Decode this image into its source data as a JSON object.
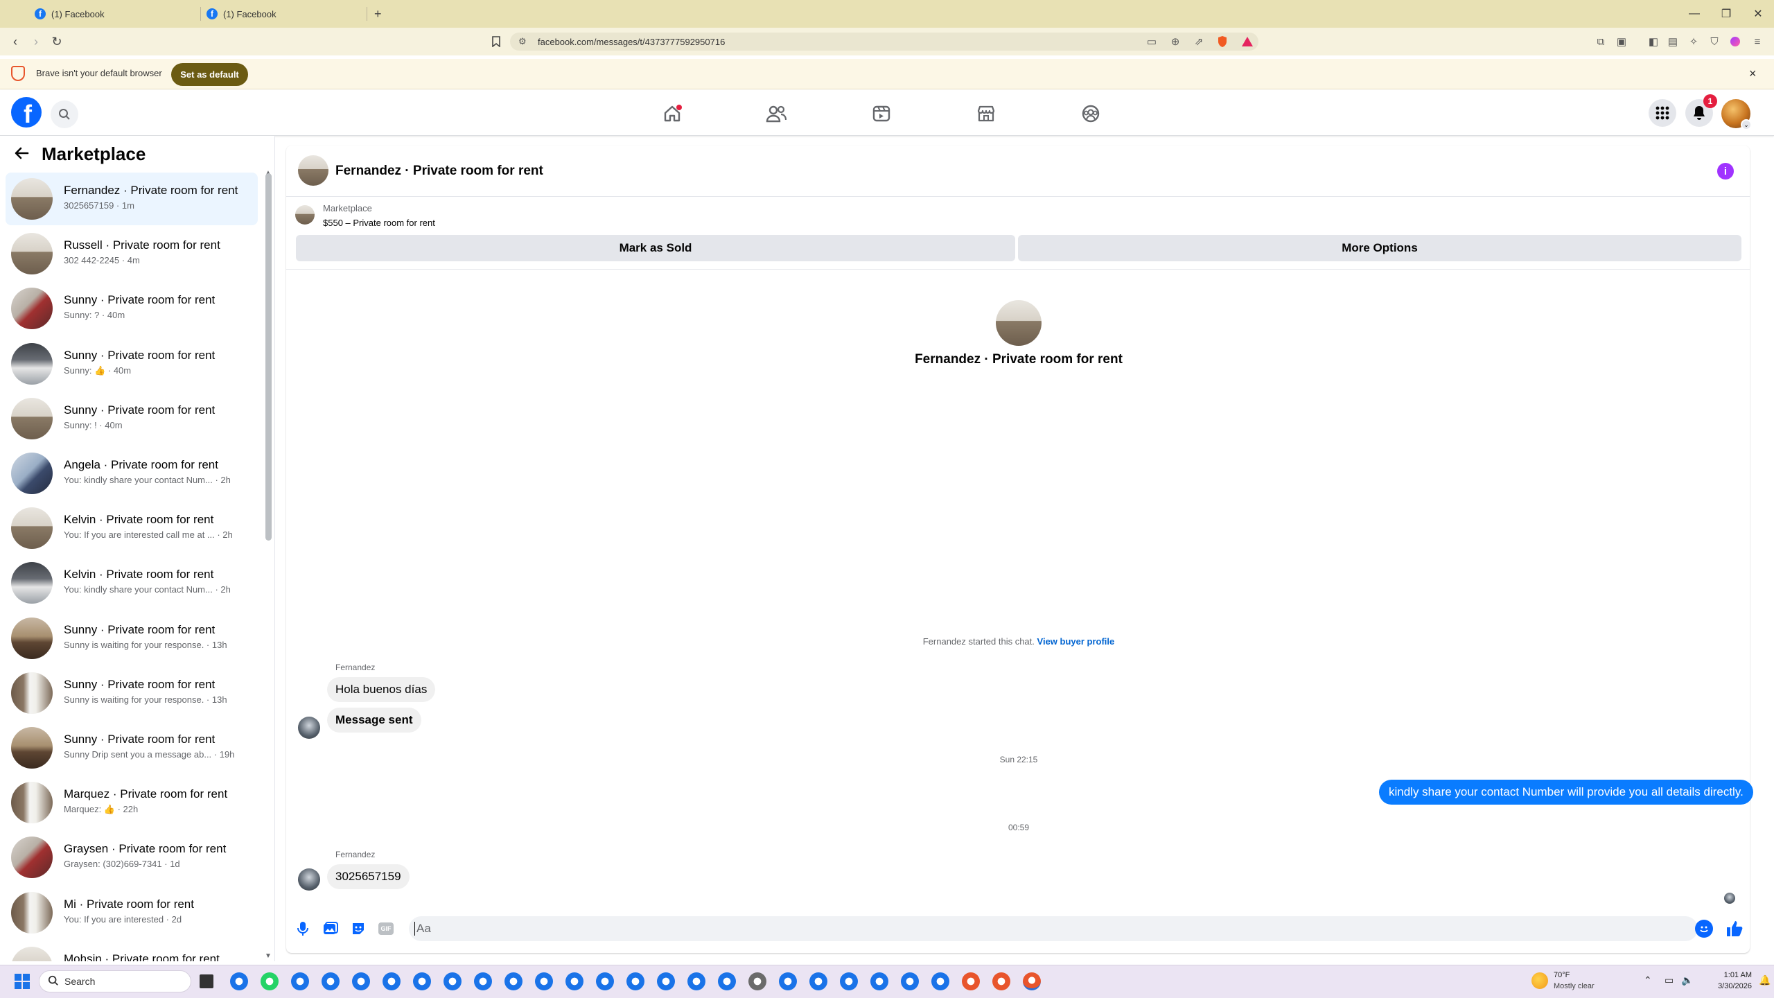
{
  "browser": {
    "tabs": [
      {
        "title": "(1) Facebook",
        "active": true
      },
      {
        "title": "(1) Facebook",
        "active": false
      }
    ],
    "new_tab": "+",
    "url": "facebook.com/messages/t/4373777592950716",
    "infobar": {
      "message": "Brave isn't your default browser",
      "button": "Set as default",
      "close": "×"
    }
  },
  "facebook": {
    "logo": "f",
    "notifications_count": "1",
    "accent": "#0866ff"
  },
  "sidebar": {
    "title": "Marketplace",
    "conversations": [
      {
        "name": "Fernandez · Private room for rent",
        "preview": "3025657159 · 1m",
        "active": true,
        "photo": "room-bright"
      },
      {
        "name": "Russell · Private room for rent",
        "preview": "302 442-2245 · 4m",
        "photo": "room-bright"
      },
      {
        "name": "Sunny · Private room for rent",
        "preview": "Sunny: ? · 40m",
        "photo": "room-red"
      },
      {
        "name": "Sunny · Private room for rent",
        "preview": "Sunny: 👍 · 40m",
        "photo": "room-dark"
      },
      {
        "name": "Sunny · Private room for rent",
        "preview": "Sunny: ! · 40m",
        "photo": "room-bright"
      },
      {
        "name": "Angela · Private room for rent",
        "preview": "You: kindly share your contact Num... · 2h",
        "photo": "room-blue"
      },
      {
        "name": "Kelvin · Private room for rent",
        "preview": "You: If you are interested call me at ... · 2h",
        "photo": "room-bright"
      },
      {
        "name": "Kelvin · Private room for rent",
        "preview": "You: kindly share your contact Num... · 2h",
        "photo": "room-dark"
      },
      {
        "name": "Sunny · Private room for rent",
        "preview": "Sunny is waiting for your response. · 13h",
        "photo": "room-brown"
      },
      {
        "name": "Sunny · Private room for rent",
        "preview": "Sunny is waiting for your response. · 13h",
        "photo": "room-window"
      },
      {
        "name": "Sunny · Private room for rent",
        "preview": "Sunny Drip sent you a message ab... · 19h",
        "photo": "room-brown"
      },
      {
        "name": "Marquez · Private room for rent",
        "preview": "Marquez: 👍 · 22h",
        "photo": "room-window"
      },
      {
        "name": "Graysen · Private room for rent",
        "preview": "Graysen: (302)669-7341 · 1d",
        "photo": "room-red"
      },
      {
        "name": "Mi · Private room for rent",
        "preview": "You: If you are interested · 2d",
        "photo": "room-window"
      },
      {
        "name": "Mohsin · Private room for rent",
        "preview": "",
        "photo": "room-bright"
      }
    ]
  },
  "chat": {
    "title": "Fernandez · Private room for rent",
    "marketplace_label": "Marketplace",
    "listing": "$550 – Private room for rent",
    "mark_sold": "Mark as Sold",
    "more_options": "More Options",
    "intro_title": "Fernandez · Private room for rent",
    "started_text": "Fernandez started this chat.",
    "view_profile": "View buyer profile",
    "messages": [
      {
        "sender": "Fernandez",
        "text": "Hola buenos días",
        "direction": "in"
      },
      {
        "text": "Message sent",
        "direction": "in"
      },
      {
        "timestamp": "Sun 22:15"
      },
      {
        "text": "kindly share your contact Number will provide you all details directly.",
        "direction": "out"
      },
      {
        "timestamp": "00:59"
      },
      {
        "sender": "Fernandez",
        "text": "3025657159",
        "direction": "in"
      }
    ],
    "composer_placeholder": "Aa",
    "outgoing_color": "#0a7cff"
  },
  "taskbar": {
    "search_placeholder": "Search",
    "weather_temp": "70°F",
    "weather_desc": "Mostly clear",
    "time": "1:01 AM",
    "date": "3/30/2026"
  }
}
